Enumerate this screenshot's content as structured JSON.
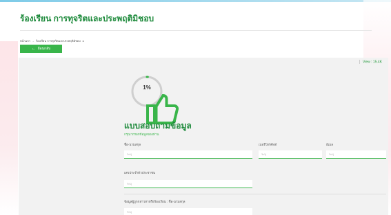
{
  "page": {
    "title": "ร้องเรียน การทุจริตและประพฤติมิชอบ"
  },
  "breadcrumb": {
    "home": "หน้าแรก",
    "current": "ร้องเรียน การทุจริตและประพฤติมิชอบ"
  },
  "back_button": {
    "label": "ย้อนกลับ"
  },
  "view": {
    "label": "View : 15.4K"
  },
  "progress": {
    "percent_text": "1%",
    "value": 0.01
  },
  "form": {
    "title": "แบบสอบถามข้อมูล",
    "subtitle": "กรุณากรอกข้อมูลของท่าน",
    "fields": {
      "name": {
        "label": "ชื่อ-นามสกุล",
        "placeholder": "ระบุ"
      },
      "phone": {
        "label": "เบอร์โทรศัพท์",
        "placeholder": "ระบุ"
      },
      "email": {
        "label": "อีเมล",
        "placeholder": "ระบุ"
      },
      "id_card": {
        "label": "เลขประจำตัวประชาชน",
        "placeholder": "ระบุ"
      },
      "accused_name": {
        "label": "ข้อมูลผู้ถูกกล่าวหาหรือร้องเรียน : ชื่อ-นามสกุล",
        "placeholder": "ระบุ"
      }
    }
  },
  "colors": {
    "accent": "#39b54a",
    "title_green": "#1d8a3b",
    "card_bg": "#f2f2f2"
  }
}
